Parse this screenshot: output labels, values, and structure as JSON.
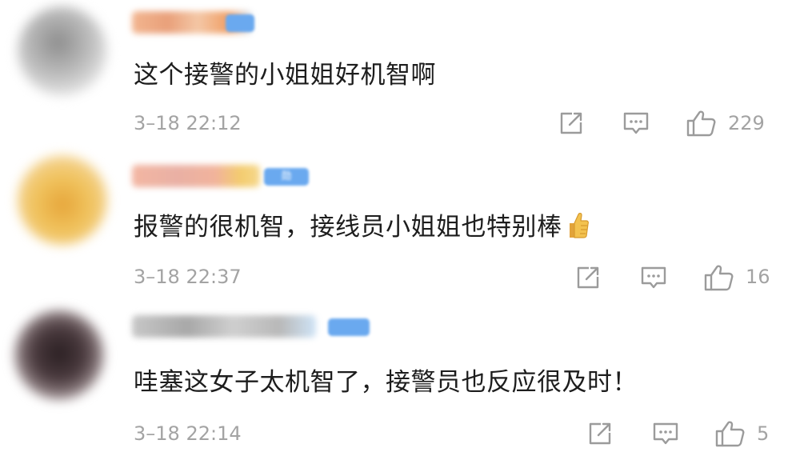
{
  "comments": [
    {
      "text": "这个接警的小姐姐好机智啊",
      "time": "3–18 22:12",
      "likes": "229"
    },
    {
      "text": "报警的很机智，接线员小姐姐也特别棒",
      "emoji": "thumbs-up-emoji",
      "badge": "勋",
      "time": "3–18 22:37",
      "likes": "16"
    },
    {
      "text": "哇塞这女子太机智了，接警员也反应很及时！",
      "time": "3–18 22:14",
      "likes": "5"
    }
  ],
  "icons": {
    "share": "share-icon",
    "reply": "comment-icon",
    "like": "thumbs-up-icon"
  },
  "colors": {
    "text": "#1d1d1d",
    "meta": "#a3a3a3",
    "background": "#ffffff"
  }
}
